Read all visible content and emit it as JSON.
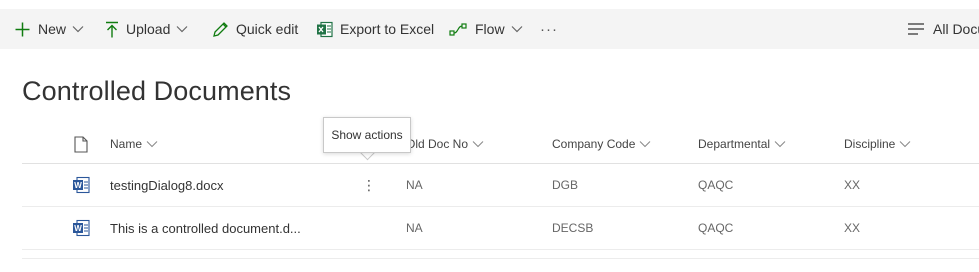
{
  "commandbar": {
    "new_label": "New",
    "upload_label": "Upload",
    "quickedit_label": "Quick edit",
    "export_label": "Export to Excel",
    "flow_label": "Flow",
    "more_label": "···",
    "view_label": "All Docu"
  },
  "page": {
    "title": "Controlled Documents"
  },
  "tooltip": {
    "text": "Show actions"
  },
  "table": {
    "columns": {
      "name": "Name",
      "old_doc_no": "Old Doc No",
      "company_code": "Company Code",
      "departmental": "Departmental",
      "discipline": "Discipline"
    },
    "rows": [
      {
        "name": "testingDialog8.docx",
        "old_doc_no": "NA",
        "company_code": "DGB",
        "departmental": "QAQC",
        "discipline": "XX"
      },
      {
        "name": "This is a controlled document.d...",
        "old_doc_no": "NA",
        "company_code": "DECSB",
        "departmental": "QAQC",
        "discipline": "XX"
      }
    ],
    "more_actions_glyph": "⋮"
  },
  "colors": {
    "accent": "#107c10",
    "excel_green": "#217346",
    "word_blue": "#2b579a",
    "commandbar_bg": "#f4f4f4"
  },
  "icons": {
    "new": "add-icon",
    "upload": "upload-icon",
    "quickedit": "pencil-icon",
    "export": "excel-icon",
    "flow": "flow-icon",
    "view": "list-view-icon",
    "file": "document-icon",
    "word": "word-file-icon"
  }
}
